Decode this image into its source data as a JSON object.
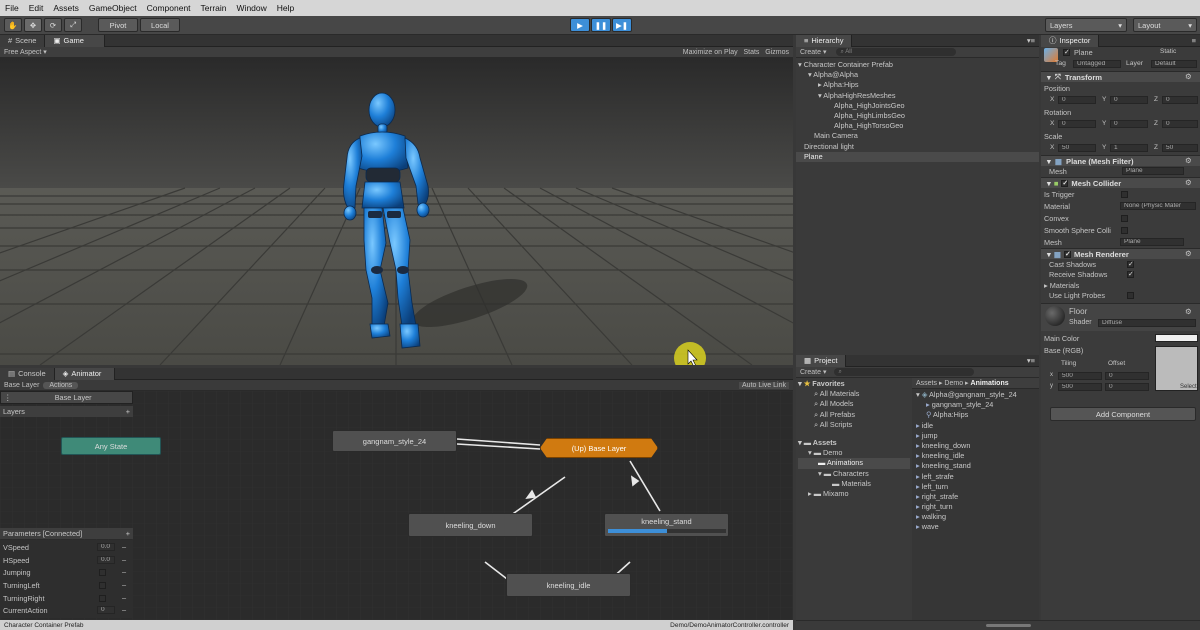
{
  "menu": [
    "File",
    "Edit",
    "Assets",
    "GameObject",
    "Component",
    "Terrain",
    "Window",
    "Help"
  ],
  "toolbar": {
    "pivot": "Pivot",
    "local": "Local",
    "layers": "Layers",
    "layout": "Layout"
  },
  "scene": {
    "tab_scene": "Scene",
    "tab_game": "Game",
    "aspect": "Free Aspect",
    "maximize": "Maximize on Play",
    "stats": "Stats",
    "gizmos": "Gizmos"
  },
  "hierarchy": {
    "title": "Hierarchy",
    "create": "Create",
    "search_placeholder": "All",
    "items": [
      "Character Container Prefab",
      "Alpha@Alpha",
      "Alpha:Hips",
      "AlphaHighResMeshes",
      "Alpha_HighJointsGeo",
      "Alpha_HighLimbsGeo",
      "Alpha_HighTorsoGeo",
      "Main Camera",
      "Directional light",
      "Plane"
    ]
  },
  "animator": {
    "tab_console": "Console",
    "tab_animator": "Animator",
    "breadcrumb_layer": "Base Layer",
    "breadcrumb_actions": "Actions",
    "auto_live": "Auto Live Link",
    "layer_item": "Base Layer",
    "layers_label": "Layers",
    "params_label": "Parameters [Connected]",
    "params": [
      {
        "name": "VSpeed",
        "value": "0.0"
      },
      {
        "name": "HSpeed",
        "value": "0.0"
      },
      {
        "name": "Jumping",
        "value": ""
      },
      {
        "name": "TurningLeft",
        "value": ""
      },
      {
        "name": "TurningRight",
        "value": ""
      },
      {
        "name": "CurrentAction",
        "value": "0"
      }
    ],
    "states": {
      "any": "Any State",
      "gangnam": "gangnam_style_24",
      "base": "(Up) Base Layer",
      "kneeling_down": "kneeling_down",
      "kneeling_stand": "kneeling_stand",
      "kneeling_idle": "kneeling_idle"
    },
    "progress": 0.5
  },
  "project": {
    "title": "Project",
    "create": "Create",
    "favorites": "Favorites",
    "fav_items": [
      "All Materials",
      "All Models",
      "All Prefabs",
      "All Scripts"
    ],
    "assets": "Assets",
    "asset_tree": [
      "Demo",
      "Animations",
      "Characters",
      "Materials",
      "Mixamo"
    ],
    "breadcrumb": [
      "Assets",
      "Demo",
      "Animations"
    ],
    "files": [
      "Alpha@gangnam_style_24",
      "gangnam_style_24",
      "Alpha:Hips",
      "idle",
      "jump",
      "kneeling_down",
      "kneeling_idle",
      "kneeling_stand",
      "left_strafe",
      "left_turn",
      "right_strafe",
      "right_turn",
      "walking",
      "wave"
    ]
  },
  "inspector": {
    "title": "Inspector",
    "object_name": "Plane",
    "static": "Static",
    "tag_label": "Tag",
    "tag_value": "Untagged",
    "layer_label": "Layer",
    "layer_value": "Default",
    "transform": "Transform",
    "position": "Position",
    "rotation": "Rotation",
    "scale": "Scale",
    "pos": [
      "0",
      "0",
      "0"
    ],
    "rot": [
      "0",
      "0",
      "0"
    ],
    "scl": [
      "50",
      "1",
      "50"
    ],
    "mesh_filter": "Plane (Mesh Filter)",
    "mesh_label": "Mesh",
    "mesh_value": "Plane",
    "mesh_collider": "Mesh Collider",
    "is_trigger": "Is Trigger",
    "material_label": "Material",
    "material_value": "None (Physic Mater",
    "convex": "Convex",
    "smooth": "Smooth Sphere Colli",
    "collider_mesh": "Plane",
    "mesh_renderer": "Mesh Renderer",
    "cast_shadows": "Cast Shadows",
    "receive_shadows": "Receive Shadows",
    "materials": "Materials",
    "light_probes": "Use Light Probes",
    "floor": "Floor",
    "shader_label": "Shader",
    "shader_value": "Diffuse",
    "main_color": "Main Color",
    "base_rgb": "Base (RGB)",
    "tiling": "Tiling",
    "offset": "Offset",
    "tiling_x": "500",
    "tiling_y": "500",
    "offset_x": "0",
    "offset_y": "0",
    "select": "Select",
    "add_component": "Add Component"
  },
  "status": {
    "left": "Character Container Prefab",
    "right": "Demo/DemoAnimatorController.controller"
  },
  "colors": {
    "accent": "#3d8fd8",
    "state_orange": "#d07a10",
    "any_state": "#3f8a78"
  }
}
